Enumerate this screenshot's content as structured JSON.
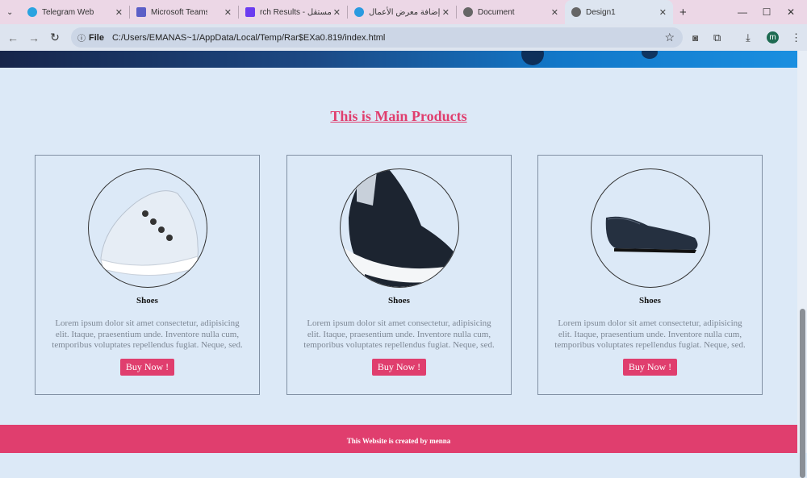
{
  "browser": {
    "tabs": [
      {
        "label": "Telegram Web",
        "color": "#2aa3e0"
      },
      {
        "label": "Microsoft Teams",
        "color": "#5b5fc7"
      },
      {
        "label": "rch Results - مستقل",
        "color": "#6b3cf0"
      },
      {
        "label": "إضافة معرض الأعمال",
        "color": "#2a9ae0"
      },
      {
        "label": "Document",
        "color": "#666"
      },
      {
        "label": "Design1",
        "color": "#666"
      }
    ],
    "new_tab": "+",
    "url_scheme": "File",
    "url": "C:/Users/EMANAS~1/AppData/Local/Temp/Rar$EXa0.819/index.html",
    "profile_initial": "m"
  },
  "page": {
    "heading": "This is Main Products",
    "products": [
      {
        "title": "Shoes",
        "description": "Lorem ipsum dolor sit amet consectetur, adipisicing elit. Itaque, praesentium unde. Inventore nulla cum, temporibus voluptates repellendus fugiat. Neque, sed.",
        "button": "Buy Now !",
        "image": "white-sneaker"
      },
      {
        "title": "Shoes",
        "description": "Lorem ipsum dolor sit amet consectetur, adipisicing elit. Itaque, praesentium unde. Inventore nulla cum, temporibus voluptates repellendus fugiat. Neque, sed.",
        "button": "Buy Now !",
        "image": "black-sneaker"
      },
      {
        "title": "Shoes",
        "description": "Lorem ipsum dolor sit amet consectetur, adipisicing elit. Itaque, praesentium unde. Inventore nulla cum, temporibus voluptates repellendus fugiat. Neque, sed.",
        "button": "Buy Now !",
        "image": "black-loafer"
      }
    ],
    "footer": "This Website is created by menna",
    "accent": "#e03e6e"
  }
}
